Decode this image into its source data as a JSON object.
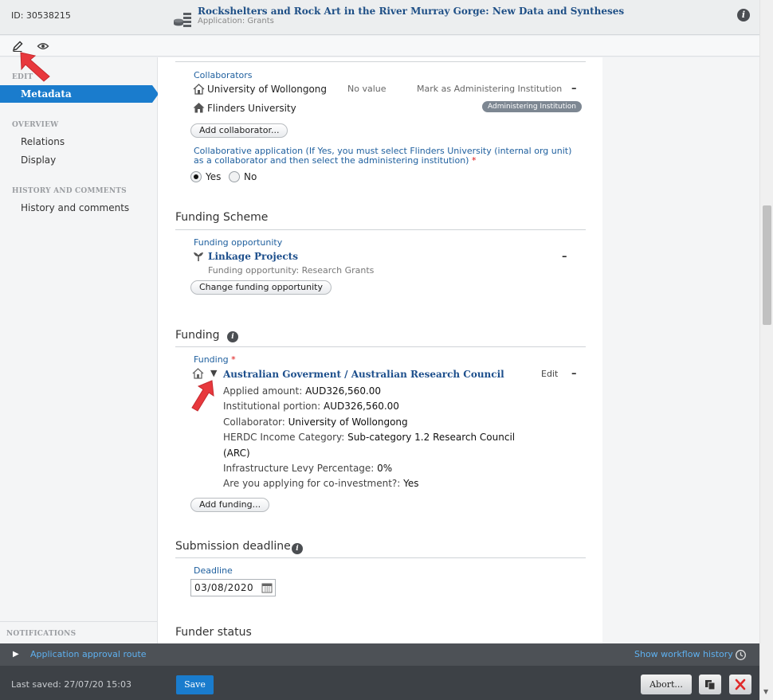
{
  "header": {
    "record_id": "ID: 30538215",
    "title": "Rockshelters and Rock Art in the River Murray Gorge: New Data and Syntheses",
    "subtitle": "Application: Grants",
    "icons": [
      "stack-icon",
      "info-icon"
    ]
  },
  "toolbar": {
    "icons": [
      "pencil-icon",
      "eye-icon"
    ]
  },
  "sidebar": {
    "edit_heading": "EDIT",
    "edit_item": "Metadata",
    "overview_heading": "OVERVIEW",
    "overview_items": [
      "Relations",
      "Display"
    ],
    "history_heading": "HISTORY AND COMMENTS",
    "history_items": [
      "History and comments"
    ],
    "notifications_heading": "NOTIFICATIONS"
  },
  "collaborators": {
    "label": "Collaborators",
    "rows": [
      {
        "name": "University of Wollongong",
        "value": "No value",
        "action": "Mark as Administering Institution"
      },
      {
        "name": "Flinders University",
        "badge": "Administering Institution"
      }
    ],
    "add_button": "Add collaborator...",
    "question": "Collaborative application (If Yes, you must select Flinders University (internal org unit) as a collaborator and then select the administering institution)",
    "required_mark": "*",
    "options": [
      "Yes",
      "No"
    ],
    "selected": "Yes"
  },
  "funding_scheme": {
    "title": "Funding Scheme",
    "label": "Funding opportunity",
    "name": "Linkage Projects",
    "detail": "Funding opportunity: Research Grants",
    "change_button": "Change funding opportunity"
  },
  "funding": {
    "title": "Funding",
    "label": "Funding",
    "required_mark": "*",
    "name": "Australian Goverment / Australian Research Council",
    "edit": "Edit",
    "details": [
      {
        "key": "Applied amount: ",
        "value": "AUD326,560.00"
      },
      {
        "key": "Institutional portion: ",
        "value": "AUD326,560.00"
      },
      {
        "key": "Collaborator: ",
        "value": "University of Wollongong"
      },
      {
        "key": "HERDC Income Category: ",
        "value": "Sub-category 1.2 Research Council"
      },
      {
        "key": "",
        "value": "(ARC)"
      },
      {
        "key": "Infrastructure Levy Percentage: ",
        "value": "0%"
      },
      {
        "key": "Are you applying for co-investment?: ",
        "value": "Yes"
      }
    ],
    "add_button": "Add funding..."
  },
  "submission": {
    "title": "Submission deadline",
    "label": "Deadline",
    "date": "03/08/2020"
  },
  "funder_status": {
    "title": "Funder status"
  },
  "workflow": {
    "route": "Application approval route",
    "history": "Show workflow history"
  },
  "footer": {
    "last_saved": "Last saved: 27/07/20 15:03",
    "save": "Save",
    "abort": "Abort..."
  },
  "colors": {
    "accent": "#1a7ccd",
    "link": "#1d4f8c",
    "annotation_arrow": "#e8383d"
  }
}
